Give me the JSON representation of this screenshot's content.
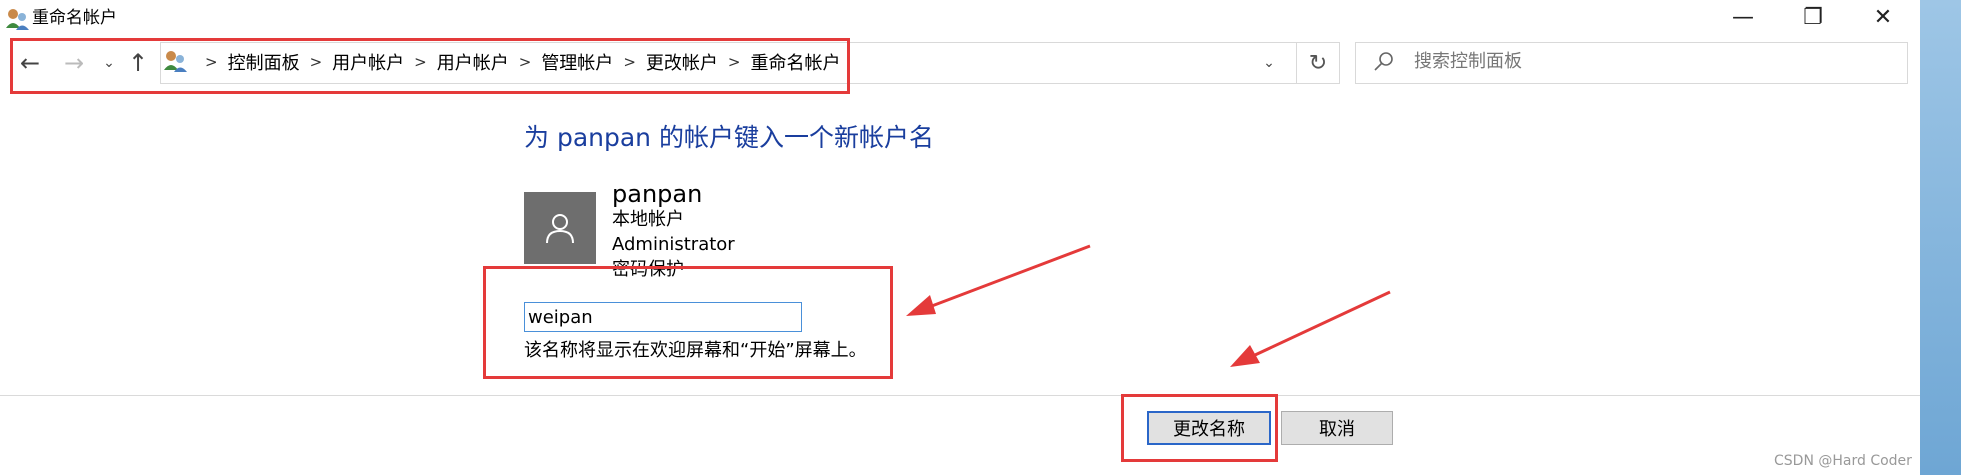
{
  "window": {
    "title": "重命名帐户",
    "min_glyph": "—",
    "max_glyph": "❐",
    "close_glyph": "✕"
  },
  "nav": {
    "back_glyph": "←",
    "forward_glyph": "→",
    "recent_glyph": "⌄",
    "up_glyph": "↑",
    "dropdown_glyph": "⌄",
    "refresh_glyph": "↻"
  },
  "breadcrumb": [
    "控制面板",
    "用户帐户",
    "用户帐户",
    "管理帐户",
    "更改帐户",
    "重命名帐户"
  ],
  "search": {
    "placeholder": "搜索控制面板"
  },
  "main": {
    "heading": "为 panpan 的帐户键入一个新帐户名",
    "user": {
      "name": "panpan",
      "type": "本地帐户",
      "role": "Administrator",
      "password_status": "密码保护"
    },
    "new_name_value": "weipan",
    "hint": "该名称将显示在欢迎屏幕和“开始”屏幕上。"
  },
  "buttons": {
    "rename": "更改名称",
    "cancel": "取消"
  },
  "watermark": "CSDN @Hard Coder",
  "colors": {
    "heading": "#1a3e9e",
    "annotation": "#e43a3a",
    "avatar_bg": "#6e6e6e"
  }
}
